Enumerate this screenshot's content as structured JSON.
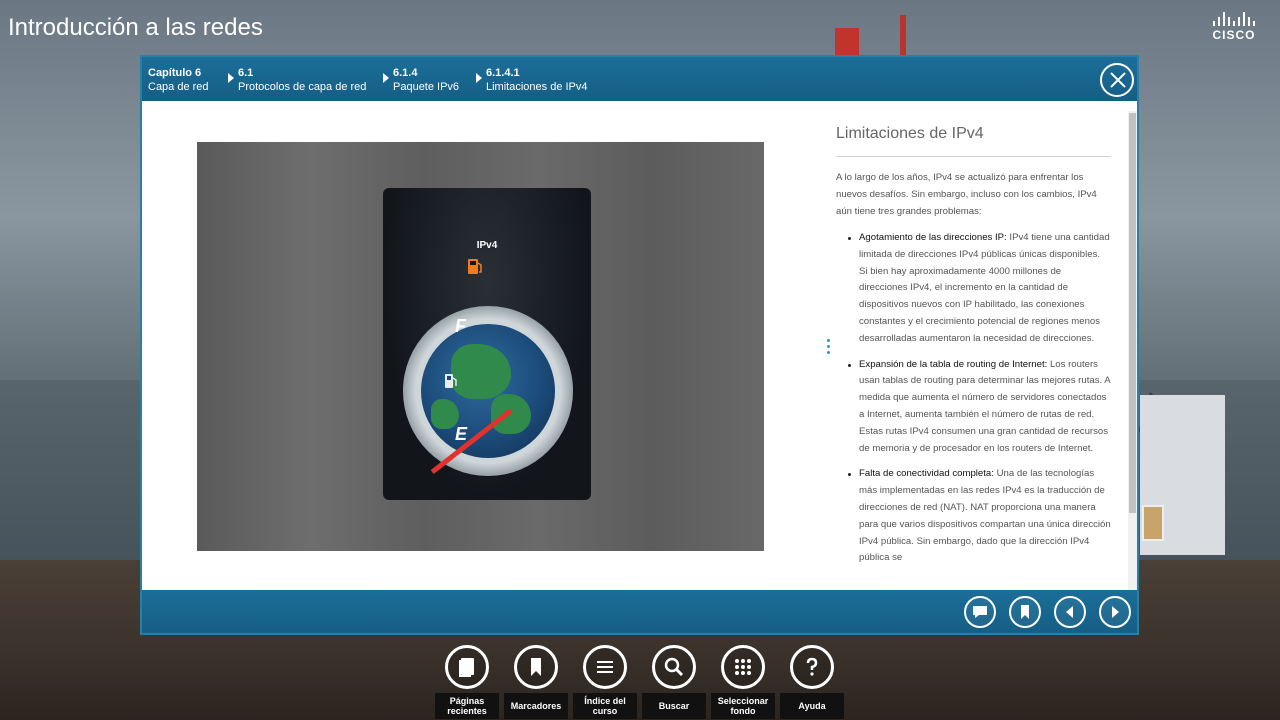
{
  "app": {
    "title": "Introducción a las redes",
    "brand": "CISCO"
  },
  "breadcrumb": [
    {
      "num": "Capítulo 6",
      "label": "Capa de red"
    },
    {
      "num": "6.1",
      "label": "Protocolos de capa de red"
    },
    {
      "num": "6.1.4",
      "label": "Paquete IPv6"
    },
    {
      "num": "6.1.4.1",
      "label": "Limitaciones de IPv4"
    }
  ],
  "figure": {
    "gauge_label": "IPv4",
    "gauge_full": "F",
    "gauge_empty": "E"
  },
  "article": {
    "title": "Limitaciones de IPv4",
    "intro": "A lo largo de los años, IPv4 se actualizó para enfrentar los nuevos desafíos. Sin embargo, incluso con los cambios, IPv4 aún tiene tres grandes problemas:",
    "bullets": [
      {
        "lead": "Agotamiento de las direcciones IP:",
        "text": " IPv4 tiene una cantidad limitada de direcciones IPv4 públicas únicas disponibles. Si bien hay aproximadamente 4000 millones de direcciones IPv4, el incremento en la cantidad de dispositivos nuevos con IP habilitado, las conexiones constantes y el crecimiento potencial de regiones menos desarrolladas aumentaron la necesidad de direcciones."
      },
      {
        "lead": "Expansión de la tabla de routing de Internet:",
        "text": " Los routers usan tablas de routing para determinar las mejores rutas. A medida que aumenta el número de servidores conectados a Internet, aumenta también el número de rutas de red. Estas rutas IPv4 consumen una gran cantidad de recursos de memoria y de procesador en los routers de Internet."
      },
      {
        "lead": "Falta de conectividad completa:",
        "text": " Una de las tecnologías más implementadas en las redes IPv4 es la traducción de direcciones de red (NAT). NAT proporciona una manera para que varios dispositivos compartan una única dirección IPv4 pública. Sin embargo, dado que la dirección IPv4 pública se"
      }
    ]
  },
  "dock": [
    {
      "label": "Páginas recientes",
      "icon": "recent-pages-icon"
    },
    {
      "label": "Marcadores",
      "icon": "bookmark-icon"
    },
    {
      "label": "Índice del curso",
      "icon": "menu-icon"
    },
    {
      "label": "Buscar",
      "icon": "search-icon"
    },
    {
      "label": "Seleccionar fondo",
      "icon": "grid-icon"
    },
    {
      "label": "Ayuda",
      "icon": "help-icon"
    }
  ],
  "colors": {
    "bar": "#1b6e99",
    "needle": "#e2322b",
    "accent": "#2f96c8"
  }
}
